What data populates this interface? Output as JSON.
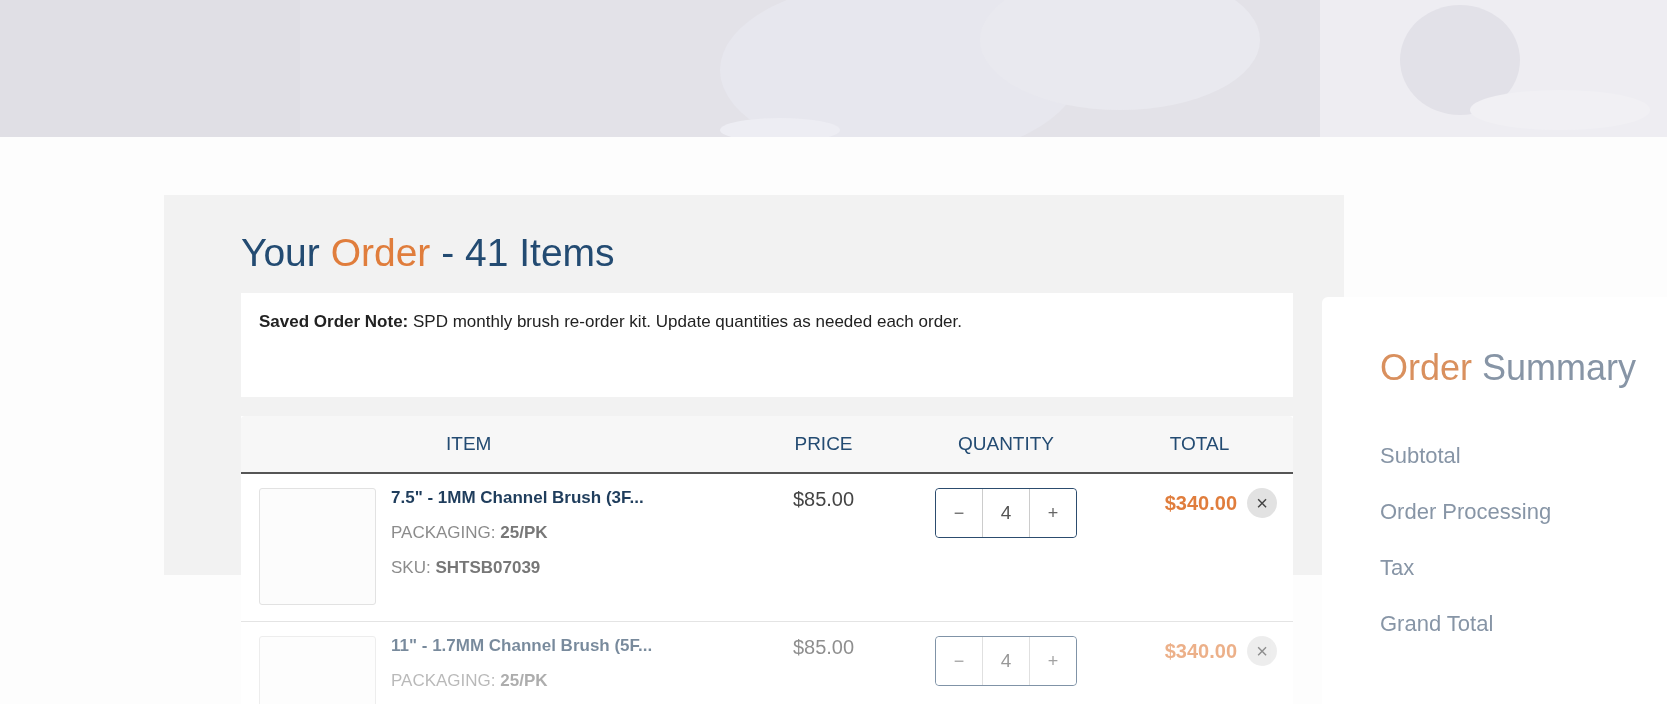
{
  "order": {
    "title_start": "Your",
    "title_accent": "Order",
    "title_end": "- 41 Items",
    "note_label": "Saved Order Note:",
    "note_text": "SPD monthly brush re-order kit. Update quantities as needed each order.",
    "columns": [
      "ITEM",
      "PRICE",
      "QUANTITY",
      "TOTAL"
    ],
    "rows": [
      {
        "name": "7.5\" - 1MM Channel Brush (3F...",
        "packaging_label": "PACKAGING:",
        "packaging": "25/PK",
        "sku_label": "SKU:",
        "sku": "SHTSB07039",
        "price": "$85.00",
        "minus": "−",
        "quantity": "4",
        "plus": "+",
        "total": "$340.00",
        "remove": "×",
        "faded": false
      },
      {
        "name": "11\" - 1.7MM Channel Brush (5F...",
        "packaging_label": "PACKAGING:",
        "packaging": "25/PK",
        "price": "$85.00",
        "minus": "−",
        "quantity": "4",
        "plus": "+",
        "total": "$340.00",
        "remove": "×",
        "faded": true
      }
    ]
  },
  "summary": {
    "title_accent": "Order",
    "title_end": "Summary",
    "lines": [
      "Subtotal",
      "Order Processing",
      "Tax",
      "Grand Total"
    ],
    "faded": true
  }
}
